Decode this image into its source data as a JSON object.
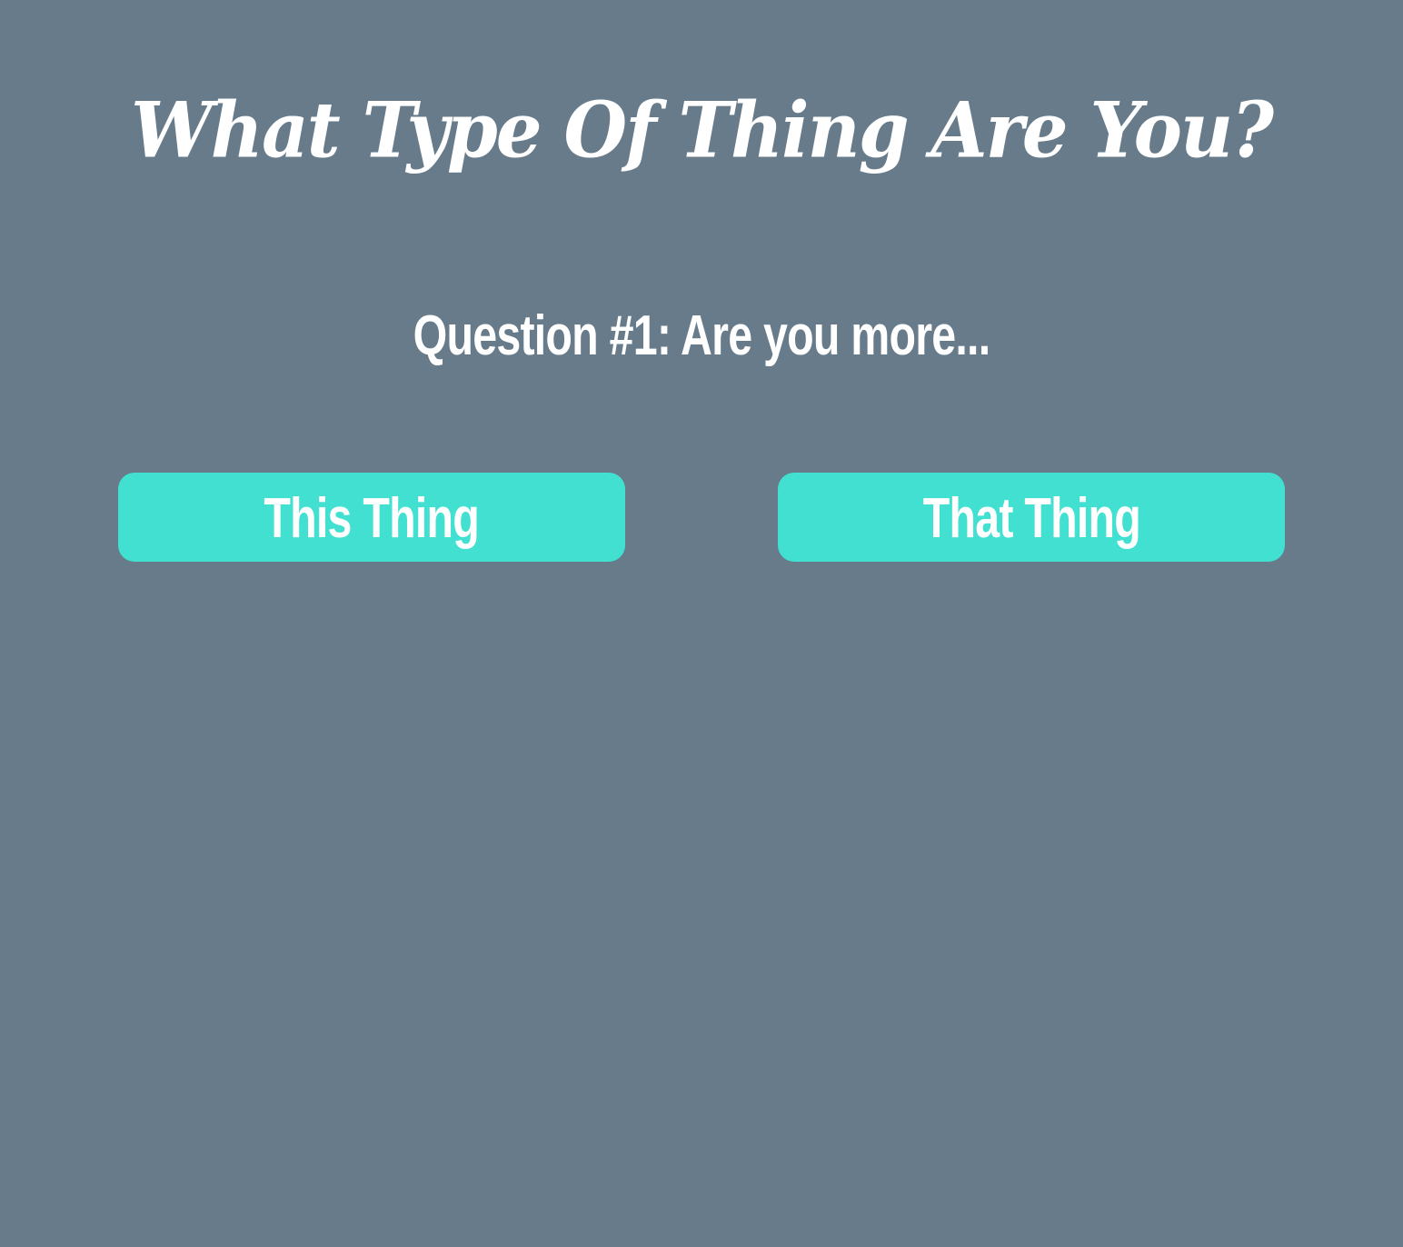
{
  "quiz": {
    "title": "What Type Of Thing Are You?",
    "question": "Question #1: Are you more...",
    "answers": [
      {
        "label": "This Thing"
      },
      {
        "label": "That Thing"
      }
    ]
  },
  "colors": {
    "background": "#677b8a",
    "button": "#41e0d0",
    "text": "#ffffff"
  }
}
